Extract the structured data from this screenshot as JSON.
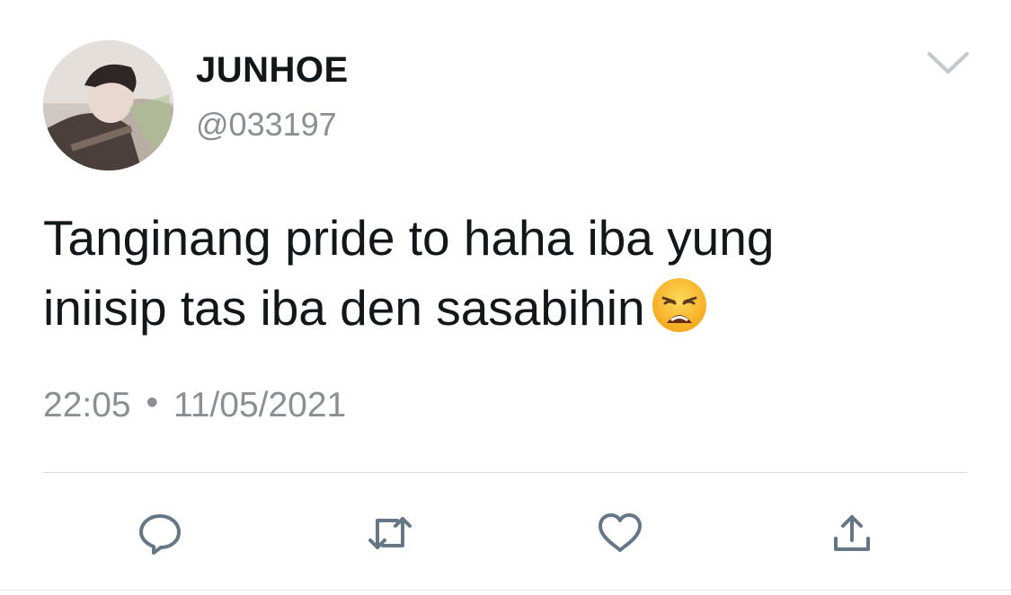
{
  "tweet": {
    "display_name": "JUNHOE",
    "handle": "@033197",
    "text_line1": "Tanginang pride to haha iba yung",
    "text_line2": "iniisip tas iba den sasabihin",
    "time": "22:05",
    "separator": "•",
    "date": "11/05/2021"
  },
  "icons": {
    "menu": "chevron-down-icon",
    "emoji": "weary-face-emoji-icon",
    "reply": "reply-bubble-icon",
    "retweet": "retweet-icon",
    "like": "heart-icon",
    "share": "share-upload-icon"
  },
  "colors": {
    "text": "#14171a",
    "secondary": "#8b8f93",
    "icon": "#657786",
    "divider": "#d8dbde"
  }
}
